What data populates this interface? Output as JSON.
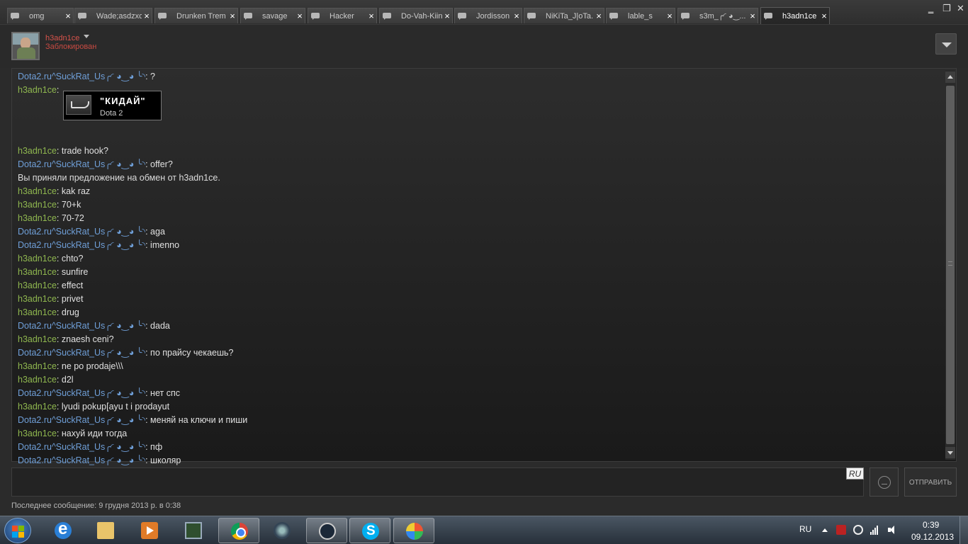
{
  "tabs": [
    {
      "label": "omg",
      "active": false
    },
    {
      "label": "Wade;asdzxc",
      "active": false
    },
    {
      "label": "Drunken Trem",
      "active": false
    },
    {
      "label": "savage",
      "active": false
    },
    {
      "label": "Hacker",
      "active": false
    },
    {
      "label": "Do-Vah-Kiin",
      "active": false
    },
    {
      "label": "Jordisson",
      "active": false
    },
    {
      "label": "NiKiTa_J|oTa...",
      "active": false
    },
    {
      "label": "lable_s",
      "active": false
    },
    {
      "label": "s3m_╭◜ ◕‿...",
      "active": false
    },
    {
      "label": "h3adn1ce",
      "active": true
    }
  ],
  "tab_close_glyph": "×",
  "window_controls": {
    "minimize": "‗",
    "restore": "❐",
    "close": "✕"
  },
  "header": {
    "username": "h3adn1ce",
    "status": "Заблокирован",
    "status_color": "#c84a42",
    "menu_icon": "chevron-down-icon"
  },
  "chat": {
    "messages": [
      {
        "who": "Dota2.ru^SuckRat_Us╭◜ ◕‿◕ ╰◝",
        "side": "them",
        "text": ": ?"
      },
      {
        "who": "h3adn1ce",
        "side": "me",
        "text": ":",
        "item": {
          "name": "\"КИДАЙ\"",
          "game": "Dota 2"
        }
      },
      {
        "who": "h3adn1ce",
        "side": "me",
        "text": ": trade hook?"
      },
      {
        "who": "Dota2.ru^SuckRat_Us╭◜ ◕‿◕ ╰◝",
        "side": "them",
        "text": ": offer?"
      },
      {
        "who": "",
        "side": "sys",
        "text": "Вы приняли предложение на обмен от h3adn1ce."
      },
      {
        "who": "h3adn1ce",
        "side": "me",
        "text": ": kak raz"
      },
      {
        "who": "h3adn1ce",
        "side": "me",
        "text": ": 70+k"
      },
      {
        "who": "h3adn1ce",
        "side": "me",
        "text": ": 70-72"
      },
      {
        "who": "Dota2.ru^SuckRat_Us╭◜ ◕‿◕ ╰◝",
        "side": "them",
        "text": ": aga"
      },
      {
        "who": "Dota2.ru^SuckRat_Us╭◜ ◕‿◕ ╰◝",
        "side": "them",
        "text": ": imenno"
      },
      {
        "who": "h3adn1ce",
        "side": "me",
        "text": ": chto?"
      },
      {
        "who": "h3adn1ce",
        "side": "me",
        "text": ": sunfire"
      },
      {
        "who": "h3adn1ce",
        "side": "me",
        "text": ": effect"
      },
      {
        "who": "h3adn1ce",
        "side": "me",
        "text": ": privet"
      },
      {
        "who": "h3adn1ce",
        "side": "me",
        "text": ": drug"
      },
      {
        "who": "Dota2.ru^SuckRat_Us╭◜ ◕‿◕ ╰◝",
        "side": "them",
        "text": ": dada"
      },
      {
        "who": "h3adn1ce",
        "side": "me",
        "text": ": znaesh ceni?"
      },
      {
        "who": "Dota2.ru^SuckRat_Us╭◜ ◕‿◕ ╰◝",
        "side": "them",
        "text": ": по прайсу чекаешь?"
      },
      {
        "who": "h3adn1ce",
        "side": "me",
        "text": ": ne po prodaje\\\\\\"
      },
      {
        "who": "h3adn1ce",
        "side": "me",
        "text": ": d2l"
      },
      {
        "who": "Dota2.ru^SuckRat_Us╭◜ ◕‿◕ ╰◝",
        "side": "them",
        "text": ": нет спс"
      },
      {
        "who": "h3adn1ce",
        "side": "me",
        "text": ": lyudi pokup[ayu t i prodayut"
      },
      {
        "who": "Dota2.ru^SuckRat_Us╭◜ ◕‿◕ ╰◝",
        "side": "them",
        "text": ": меняй на ключи и пиши"
      },
      {
        "who": "h3adn1ce",
        "side": "me",
        "text": ": нахуй иди тогда"
      },
      {
        "who": "Dota2.ru^SuckRat_Us╭◜ ◕‿◕ ╰◝",
        "side": "them",
        "text": ": пф"
      },
      {
        "who": "Dota2.ru^SuckRat_Us╭◜ ◕‿◕ ╰◝",
        "side": "them",
        "text": ": школяр"
      }
    ],
    "colors": {
      "me": "#8fb74f",
      "them": "#6f9fd8"
    }
  },
  "input": {
    "value": "",
    "keyboard_lang": "RU",
    "send_label": "ОТПРАВИТЬ",
    "emoji_icon": "emoticon-icon"
  },
  "footer": {
    "last_message": "Последнее сообщение: 9 грудня 2013 р. в 0:38"
  },
  "taskbar": {
    "apps": [
      {
        "name": "internet-explorer",
        "open": false
      },
      {
        "name": "windows-explorer",
        "open": false
      },
      {
        "name": "media-center",
        "open": false
      },
      {
        "name": "task-manager",
        "open": false
      },
      {
        "name": "google-chrome",
        "open": true
      },
      {
        "name": "audio-app",
        "open": false
      },
      {
        "name": "steam",
        "open": true
      },
      {
        "name": "skype",
        "open": true
      },
      {
        "name": "paint",
        "open": true
      }
    ],
    "language": "RU",
    "time": "0:39",
    "date": "09.12.2013"
  }
}
